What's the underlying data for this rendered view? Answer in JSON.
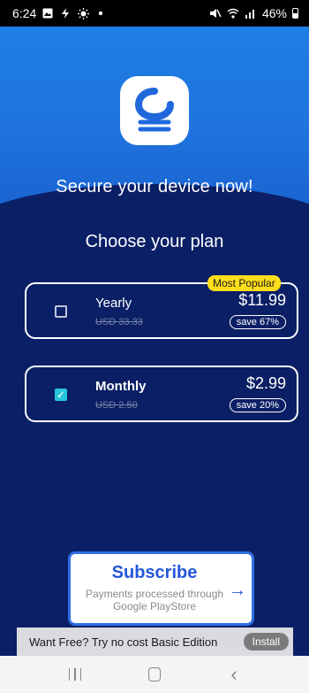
{
  "status": {
    "time": "6:24",
    "battery": "46%",
    "left_icons": [
      "gallery-icon",
      "charging-icon",
      "brightness-icon",
      "dot-icon"
    ],
    "right_icons": [
      "mute-icon",
      "wifi-icon",
      "signal-icon",
      "battery-icon"
    ]
  },
  "hero": {
    "logo": "app-logo-icon",
    "title": "Secure your device now!"
  },
  "plans": {
    "heading": "Choose your plan",
    "yearly": {
      "badge": "Most Popular",
      "name": "Yearly",
      "old_price": "USD 33.33",
      "price": "$11.99",
      "save": "save 67%",
      "checked": false
    },
    "monthly": {
      "name": "Monthly",
      "old_price": "USD 2.50",
      "price": "$2.99",
      "save": "save 20%",
      "checked": true
    }
  },
  "subscribe": {
    "title": "Subscribe",
    "subtitle": "Payments processed through Google PlayStore",
    "arrow_icon": "arrow-right-icon"
  },
  "free_bar": {
    "text": "Want Free? Try no cost Basic Edition",
    "install_label": "Install"
  },
  "nav": {
    "recents_icon": "recents-icon",
    "home_icon": "home-icon",
    "back_icon": "back-icon"
  },
  "colors": {
    "background": "#0b1f66",
    "hero": "#1e7ee4",
    "accent": "#2457d8",
    "badge": "#ffde1a",
    "check": "#26c6da"
  }
}
